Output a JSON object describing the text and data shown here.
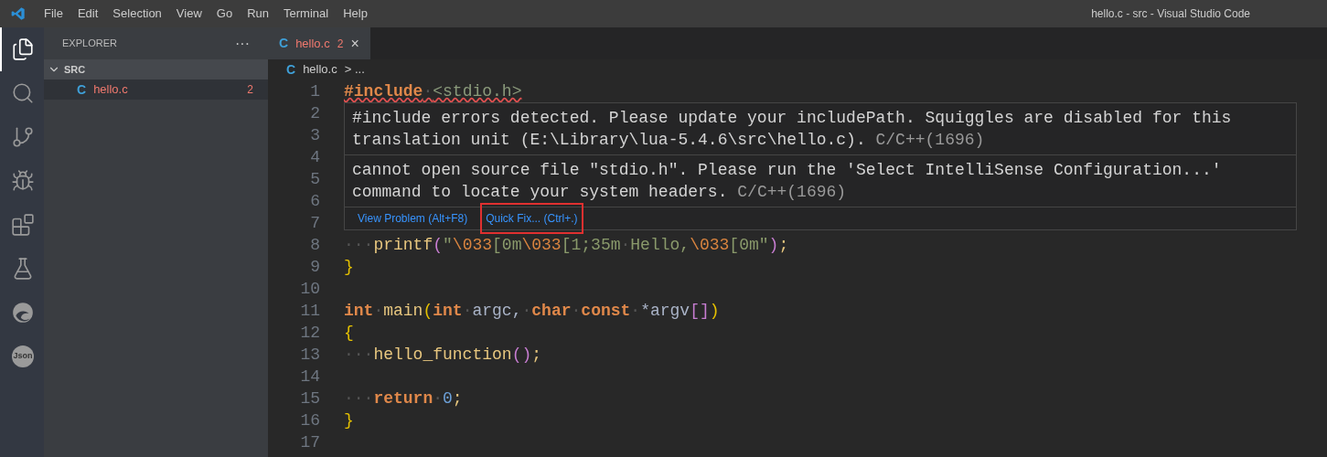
{
  "menu_bar": {
    "items": [
      "File",
      "Edit",
      "Selection",
      "View",
      "Go",
      "Run",
      "Terminal",
      "Help"
    ],
    "title": "hello.c - src - Visual Studio Code"
  },
  "activity_bar": [
    {
      "kind": "files",
      "selected": true
    },
    {
      "kind": "search",
      "selected": false
    },
    {
      "kind": "source-control",
      "selected": false
    },
    {
      "kind": "run-debug",
      "selected": false
    },
    {
      "kind": "extensions",
      "selected": false
    },
    {
      "kind": "testing",
      "selected": false
    },
    {
      "kind": "browser",
      "selected": false
    },
    {
      "kind": "json",
      "label": "Json",
      "selected": false
    }
  ],
  "sidebar": {
    "title": "EXPLORER",
    "more": "···",
    "folder": {
      "name": "SRC",
      "expanded": true,
      "files": [
        {
          "icon": "C",
          "name": "hello.c",
          "problems": "2",
          "selected": true
        }
      ]
    }
  },
  "tabs": [
    {
      "icon": "C",
      "label": "hello.c",
      "problems": "2",
      "close": "×",
      "selected": true
    }
  ],
  "breadcrumb": {
    "icon": "C",
    "file": "hello.c",
    "rest": "> ..."
  },
  "editor": {
    "lines": [
      {
        "number": "1",
        "tokens": [
          {
            "kind": "pre",
            "s": "#include"
          },
          {
            "kind": "ws",
            "s": "·"
          },
          {
            "kind": "inc",
            "s": "<stdio.h>"
          }
        ],
        "squiggle": true
      },
      {
        "number": "2"
      },
      {
        "number": "3"
      },
      {
        "number": "4"
      },
      {
        "number": "5"
      },
      {
        "number": "6"
      },
      {
        "number": "7"
      },
      {
        "number": "8",
        "tokens": [
          {
            "kind": "ws",
            "s": "···"
          },
          {
            "kind": "fn",
            "s": "printf"
          },
          {
            "kind": "paren",
            "s": "("
          },
          {
            "kind": "str",
            "s": "\""
          },
          {
            "kind": "esc",
            "s": "\\033"
          },
          {
            "kind": "str",
            "s": "[0m"
          },
          {
            "kind": "esc",
            "s": "\\033"
          },
          {
            "kind": "str",
            "s": "[1;35m"
          },
          {
            "kind": "ws",
            "s": "·"
          },
          {
            "kind": "str",
            "s": "Hello,"
          },
          {
            "kind": "esc",
            "s": "\\033"
          },
          {
            "kind": "str",
            "s": "[0m\""
          },
          {
            "kind": "paren",
            "s": ")"
          },
          {
            "kind": "fn",
            "s": ";"
          }
        ]
      },
      {
        "number": "9",
        "tokens": [
          {
            "kind": "brace",
            "s": "}"
          }
        ]
      },
      {
        "number": "10"
      },
      {
        "number": "11",
        "tokens": [
          {
            "kind": "kw",
            "s": "int"
          },
          {
            "kind": "ws",
            "s": "·"
          },
          {
            "kind": "fn",
            "s": "main"
          },
          {
            "kind": "brace",
            "s": "("
          },
          {
            "kind": "kw",
            "s": "int"
          },
          {
            "kind": "ws",
            "s": "·"
          },
          {
            "kind": "var",
            "s": "argc,"
          },
          {
            "kind": "ws",
            "s": "·"
          },
          {
            "kind": "kw",
            "s": "char"
          },
          {
            "kind": "ws",
            "s": "·"
          },
          {
            "kind": "kw",
            "s": "const"
          },
          {
            "kind": "ws",
            "s": "·"
          },
          {
            "kind": "var",
            "s": "*argv"
          },
          {
            "kind": "paren",
            "s": "[]"
          },
          {
            "kind": "brace",
            "s": ")"
          }
        ]
      },
      {
        "number": "12",
        "tokens": [
          {
            "kind": "brace",
            "s": "{"
          }
        ]
      },
      {
        "number": "13",
        "tokens": [
          {
            "kind": "ws",
            "s": "···"
          },
          {
            "kind": "fn",
            "s": "hello_function"
          },
          {
            "kind": "paren",
            "s": "()"
          },
          {
            "kind": "fn",
            "s": ";"
          }
        ]
      },
      {
        "number": "14"
      },
      {
        "number": "15",
        "tokens": [
          {
            "kind": "ws",
            "s": "···"
          },
          {
            "kind": "kw",
            "s": "return"
          },
          {
            "kind": "ws",
            "s": "·"
          },
          {
            "kind": "num",
            "s": "0"
          },
          {
            "kind": "fn",
            "s": ";"
          }
        ]
      },
      {
        "number": "16",
        "tokens": [
          {
            "kind": "brace",
            "s": "}"
          }
        ]
      },
      {
        "number": "17"
      }
    ]
  },
  "hover": {
    "problems": [
      {
        "message": "#include errors detected. Please update your includePath. Squiggles are disabled for this translation unit (E:\\Library\\lua-5.4.6\\src\\hello.c).",
        "source": "C/C++(1696)"
      },
      {
        "message": "cannot open source file \"stdio.h\". Please run the 'Select IntelliSense Configuration...' command to locate your system headers.",
        "source": "C/C++(1696)"
      }
    ],
    "actions": [
      {
        "label": "View Problem (Alt+F8)",
        "highlighted": false
      },
      {
        "label": "Quick Fix... (Ctrl+.)",
        "highlighted": true
      }
    ]
  }
}
